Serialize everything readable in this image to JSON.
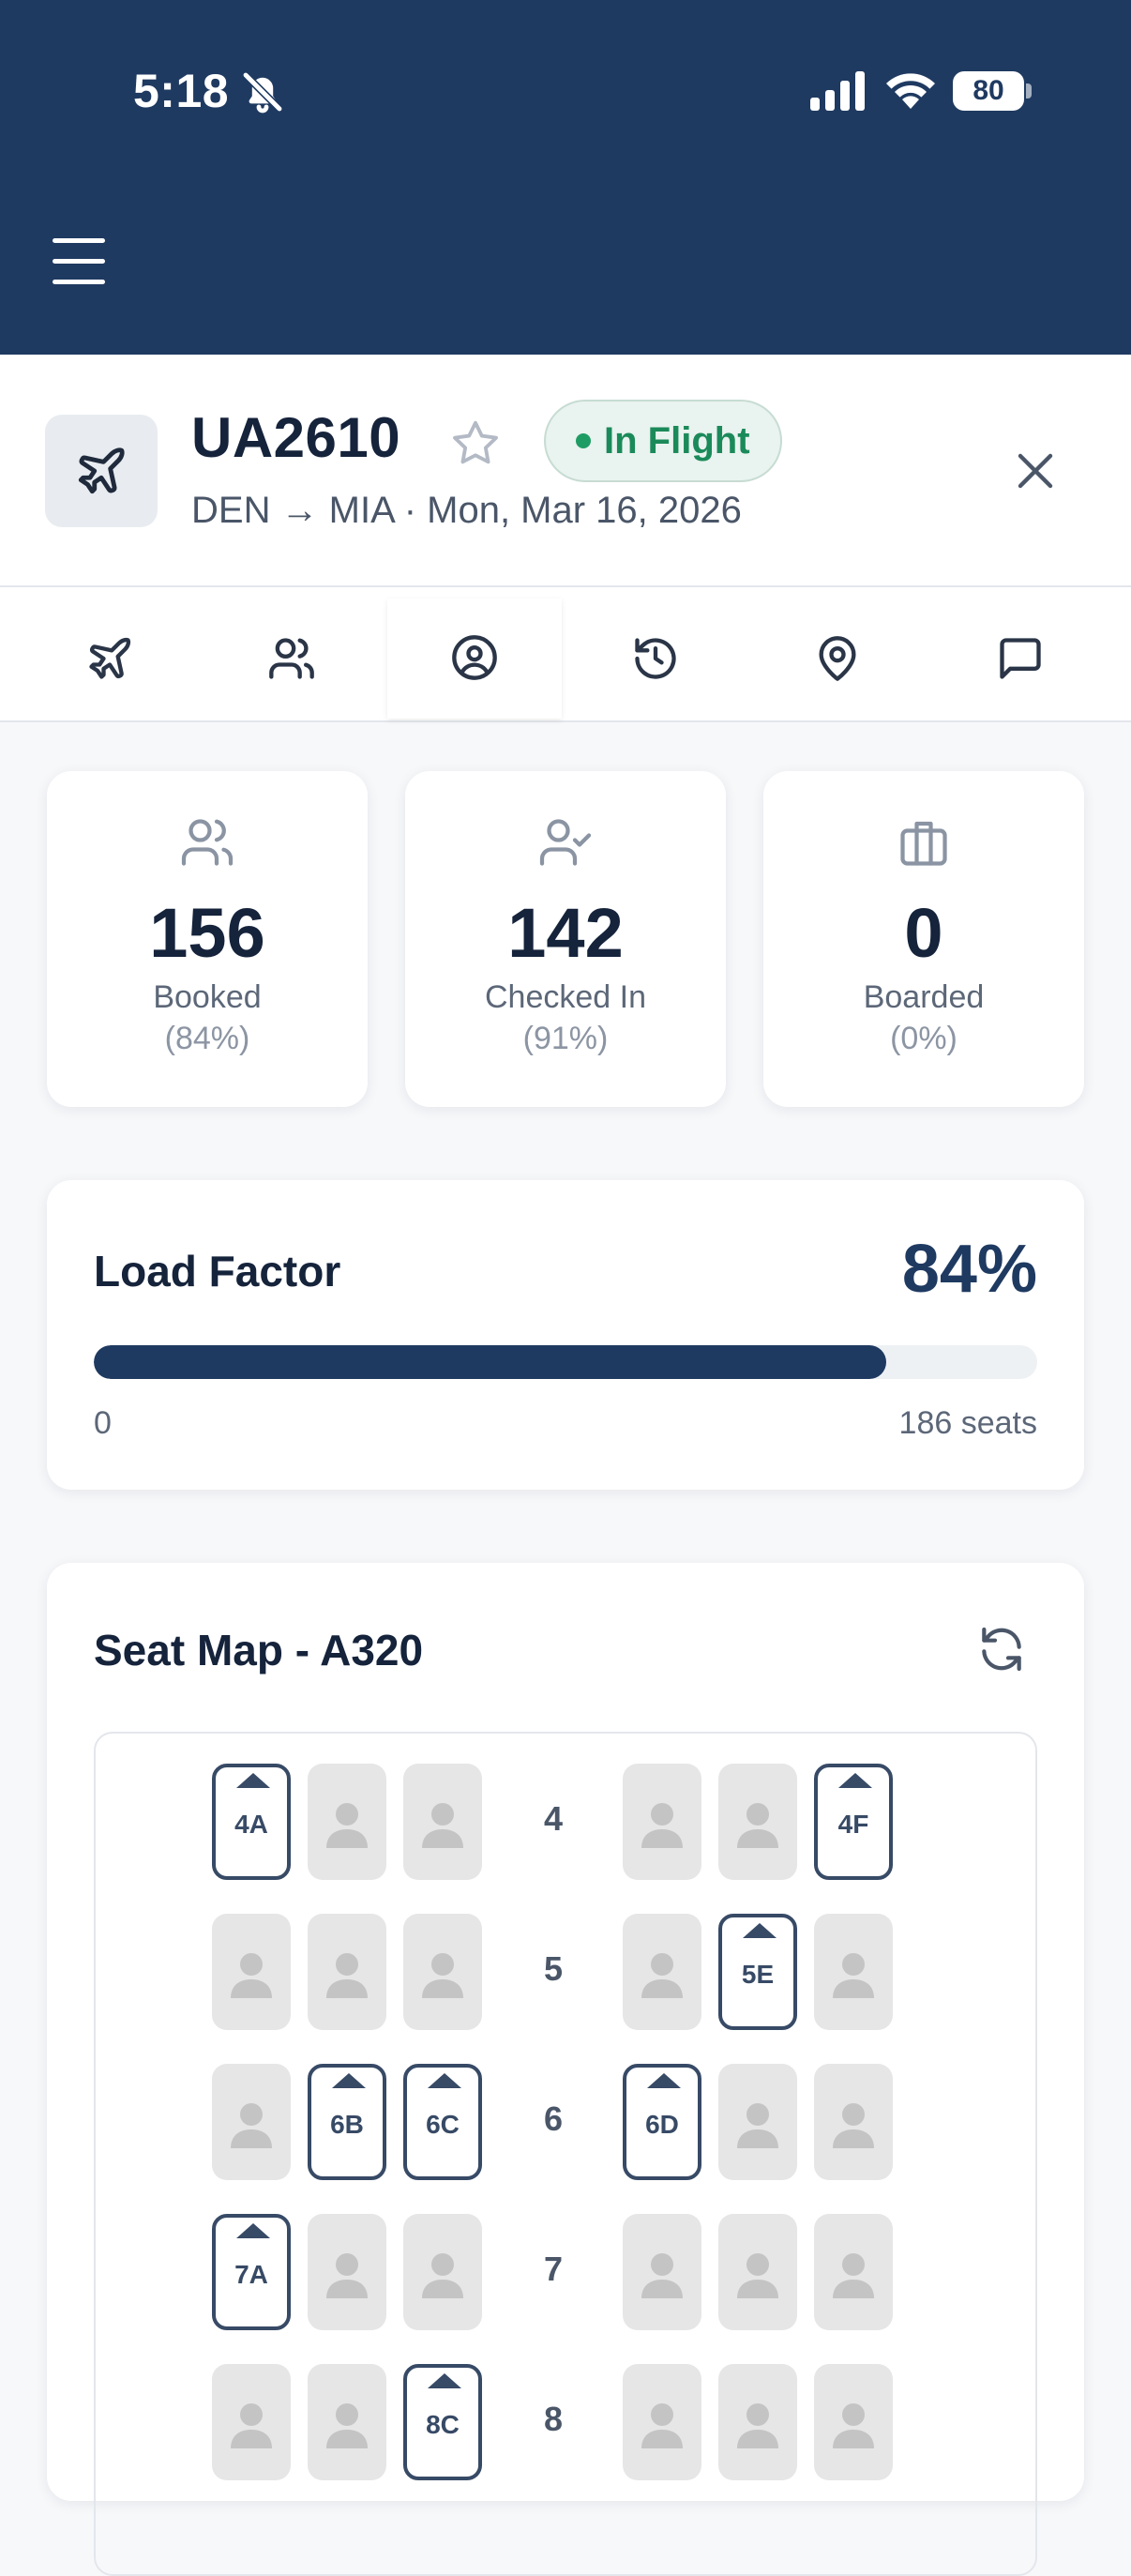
{
  "status_bar": {
    "time": "5:18",
    "battery": "80"
  },
  "flight": {
    "number": "UA2610",
    "status": "In Flight",
    "route": "DEN → MIA · Mon, Mar 16, 2026"
  },
  "tabs": [
    {
      "icon": "plane-icon",
      "active": false
    },
    {
      "icon": "users-icon",
      "active": false
    },
    {
      "icon": "user-circle-icon",
      "active": true
    },
    {
      "icon": "history-icon",
      "active": false
    },
    {
      "icon": "map-pin-icon",
      "active": false
    },
    {
      "icon": "message-icon",
      "active": false
    }
  ],
  "stats": {
    "booked": {
      "value": "156",
      "label": "Booked",
      "pct": "(84%)"
    },
    "checked_in": {
      "value": "142",
      "label": "Checked In",
      "pct": "(91%)"
    },
    "boarded": {
      "value": "0",
      "label": "Boarded",
      "pct": "(0%)"
    }
  },
  "load_factor": {
    "title": "Load Factor",
    "percent_label": "84%",
    "fill_fraction": 0.84,
    "min_label": "0",
    "max_label": "186 seats"
  },
  "seat_map": {
    "title": "Seat Map - A320",
    "rows": [
      {
        "row": "4",
        "seats": [
          {
            "id": "4A",
            "open": true
          },
          {
            "id": "4B",
            "open": false
          },
          {
            "id": "4C",
            "open": false
          },
          {
            "id": "4D",
            "open": false
          },
          {
            "id": "4E",
            "open": false
          },
          {
            "id": "4F",
            "open": true
          }
        ]
      },
      {
        "row": "5",
        "seats": [
          {
            "id": "5A",
            "open": false
          },
          {
            "id": "5B",
            "open": false
          },
          {
            "id": "5C",
            "open": false
          },
          {
            "id": "5D",
            "open": false
          },
          {
            "id": "5E",
            "open": true
          },
          {
            "id": "5F",
            "open": false
          }
        ]
      },
      {
        "row": "6",
        "seats": [
          {
            "id": "6A",
            "open": false
          },
          {
            "id": "6B",
            "open": true
          },
          {
            "id": "6C",
            "open": true
          },
          {
            "id": "6D",
            "open": true
          },
          {
            "id": "6E",
            "open": false
          },
          {
            "id": "6F",
            "open": false
          }
        ]
      },
      {
        "row": "7",
        "seats": [
          {
            "id": "7A",
            "open": true
          },
          {
            "id": "7B",
            "open": false
          },
          {
            "id": "7C",
            "open": false
          },
          {
            "id": "7D",
            "open": false
          },
          {
            "id": "7E",
            "open": false
          },
          {
            "id": "7F",
            "open": false
          }
        ]
      },
      {
        "row": "8",
        "seats": [
          {
            "id": "8A",
            "open": false
          },
          {
            "id": "8B",
            "open": false
          },
          {
            "id": "8C",
            "open": true
          },
          {
            "id": "8D",
            "open": false
          },
          {
            "id": "8E",
            "open": false
          },
          {
            "id": "8F",
            "open": false
          }
        ]
      }
    ]
  },
  "colors": {
    "navy": "#1f3a61",
    "status_green": "#1b8a5a",
    "seat_taken": "#e6e6e6",
    "seat_open_border": "#374a66"
  }
}
